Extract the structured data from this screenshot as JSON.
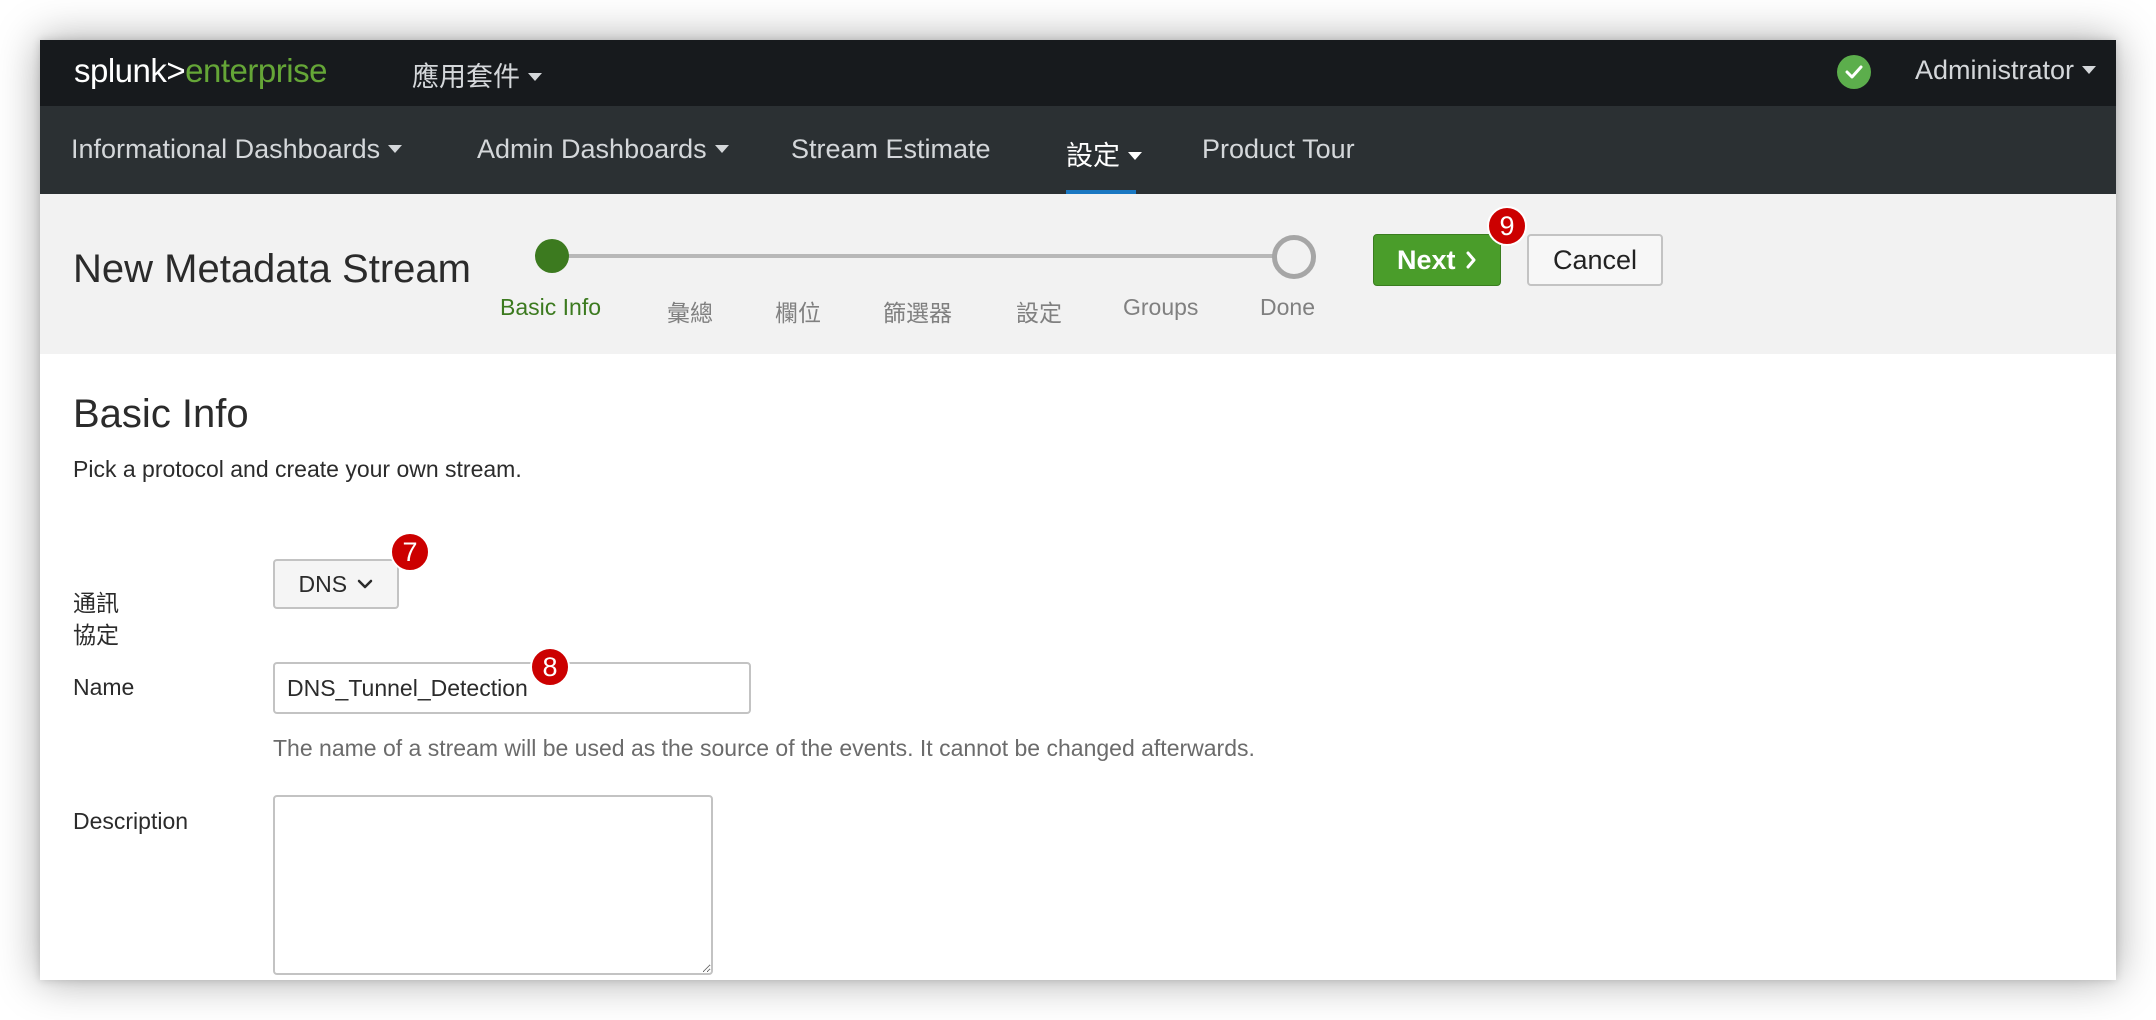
{
  "topbar": {
    "logo_left": "splunk>",
    "logo_right": "enterprise",
    "apps_label": "應用套件",
    "user_label": "Administrator"
  },
  "nav": {
    "items": [
      {
        "label": "Informational Dashboards"
      },
      {
        "label": "Admin Dashboards"
      },
      {
        "label": "Stream Estimate"
      },
      {
        "label": "設定"
      },
      {
        "label": "Product Tour"
      }
    ]
  },
  "wizard": {
    "title": "New Metadata Stream",
    "steps": [
      "Basic Info",
      "彙總",
      "欄位",
      "篩選器",
      "設定",
      "Groups",
      "Done"
    ],
    "active_step": "Basic Info",
    "next_label": "Next",
    "cancel_label": "Cancel"
  },
  "form": {
    "section_title": "Basic Info",
    "section_desc": "Pick a protocol and create your own stream.",
    "protocol_label_line1": "通訊",
    "protocol_label_line2": "協定",
    "protocol_value": "DNS",
    "name_label": "Name",
    "name_value": "DNS_Tunnel_Detection",
    "name_help": "The name of a stream will be used as the source of the events. It cannot be changed afterwards.",
    "description_label": "Description",
    "description_value": ""
  },
  "annotations": {
    "protocol_badge": "7",
    "name_badge": "8",
    "next_badge": "9"
  },
  "colors": {
    "topbar_bg": "#171a1d",
    "navbar_bg": "#2b3033",
    "brand_green": "#65a637",
    "primary_button": "#4a9d2a",
    "active_step": "#3c7a1f",
    "nav_active": "#1a78c2",
    "badge": "#cc0000"
  }
}
